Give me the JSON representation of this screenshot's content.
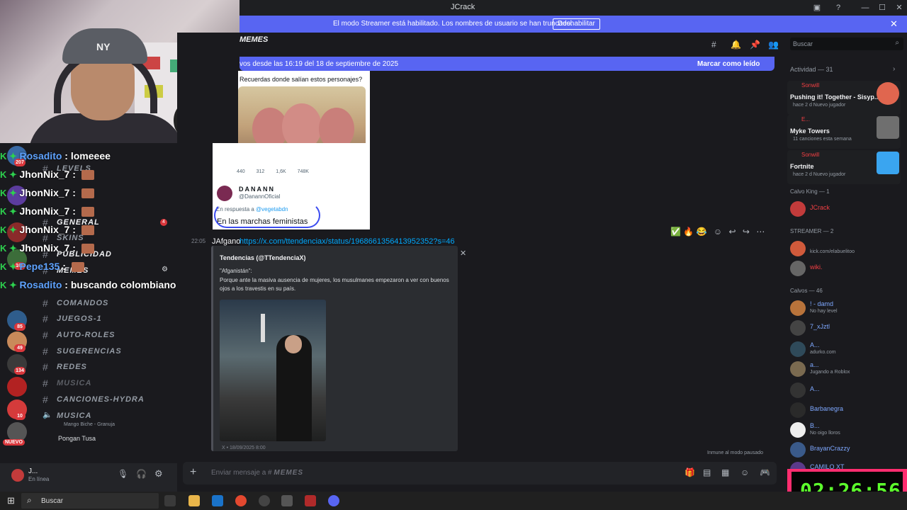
{
  "window": {
    "title": "JCrack"
  },
  "streamer_banner": {
    "text": "El modo Streamer está habilitado. Los nombres de usuario se han truncado.",
    "button": "Deshabilitar"
  },
  "channel_header": {
    "name": "MEMES"
  },
  "new_messages": {
    "text": "vos desde las 16:19 del 18 de septiembre de 2025",
    "mark_read": "Marcar como leído"
  },
  "chat_overlay": [
    {
      "user": "Rosadito",
      "message": "lomeeee"
    },
    {
      "user": "JhonNix_7",
      "message": ""
    },
    {
      "user": "JhonNix_7",
      "message": ""
    },
    {
      "user": "JhonNix_7",
      "message": ""
    },
    {
      "user": "JhonNix_7",
      "message": ""
    },
    {
      "user": "JhonNix_7",
      "message": ""
    },
    {
      "user": "Pepe135",
      "message": ""
    },
    {
      "user": "Rosadito",
      "message": "buscando colombiano"
    }
  ],
  "server_badges": [
    "207",
    "85",
    "49",
    "134",
    "10",
    "NUEVO",
    "10",
    "10",
    "166"
  ],
  "channels": [
    {
      "name": "LEVELS",
      "state": "normal"
    },
    {
      "name": "GENERAL",
      "state": "bright",
      "badge": "4"
    },
    {
      "name": "SKINS",
      "state": "normal"
    },
    {
      "name": "PUBLICIDAD",
      "state": "bright"
    },
    {
      "name": "MEMES",
      "state": "bright"
    },
    {
      "name": "COMANDOS",
      "state": "normal"
    },
    {
      "name": "JUEGOS-1",
      "state": "normal"
    },
    {
      "name": "AUTO-ROLES",
      "state": "normal"
    },
    {
      "name": "SUGERENCIAS",
      "state": "normal"
    },
    {
      "name": "REDES",
      "state": "normal"
    },
    {
      "name": "MUSICA",
      "state": "dim"
    },
    {
      "name": "CANCIONES-HYDRA",
      "state": "normal"
    },
    {
      "name": "MUSICA",
      "state": "normal"
    }
  ],
  "voice": {
    "activity": "Mango Biche - Granuja",
    "listener": "Pongan Tusa"
  },
  "user_panel": {
    "name": "J...",
    "status": "En línea"
  },
  "tweet_top": {
    "question": "Recuerdas donde salían estos personajes?",
    "stats": "440 312 1,6K 748K"
  },
  "tweet_reply": {
    "name": "DANANN",
    "handle": "@DanannOficial",
    "reply_prefix": "En respuesta a",
    "reply_to": "@vegetabdn",
    "body": "En las marchas feministas"
  },
  "message": {
    "time": "22:05",
    "author": "JAfgano",
    "link": "https://x.com/ttendenciax/status/1968661356413952352?s=46"
  },
  "embed": {
    "author": "Tendencias (@TTendenciaX)",
    "title": "\"Afganistán\":",
    "description": "Porque ante la masiva ausencia de mujeres, los musulmanes empezaron a ver con buenos ojos a los travestis en su país.",
    "footer": "X • 18/09/2025 8:00"
  },
  "immune_note": "Inmune al modo pausado",
  "composer": {
    "placeholder_prefix": "Enviar mensaje a #",
    "placeholder_channel": "MEMES"
  },
  "search": {
    "placeholder": "Buscar"
  },
  "activity": {
    "header": "Actividad — 31",
    "cards": [
      {
        "who": "Sonwill",
        "what": "Pushing it! Together - Sisyp...",
        "meta": "hace 2 d  Nuevo jugador",
        "color": "#e0664f"
      },
      {
        "who": "E...",
        "what": "Myke Towers",
        "meta": "11 canciones esta semana",
        "color": "#8a8a8a"
      },
      {
        "who": "Sonwill",
        "what": "Fortnite",
        "meta": "hace 2 d  Nuevo jugador",
        "color": "#3aa5f0"
      }
    ]
  },
  "member_sections": [
    {
      "title": "Calvo King — 1",
      "members": [
        {
          "name": "JCrack",
          "sub": "",
          "color": "#f23f43"
        }
      ]
    },
    {
      "title": "STREAMER — 2",
      "members": [
        {
          "name": "",
          "sub": "kick.com/elabuelitoo",
          "color": "#f2f3f5"
        },
        {
          "name": "wiki.",
          "sub": "",
          "color": "#f23f43"
        }
      ]
    },
    {
      "title": "Calvos — 46",
      "members": [
        {
          "name": "! - damd",
          "sub": "No hay level",
          "color": "#7ea8ff"
        },
        {
          "name": "7_xJztl",
          "sub": "",
          "color": "#7ea8ff"
        },
        {
          "name": "A...",
          "sub": "adurko.com",
          "color": "#7ea8ff"
        },
        {
          "name": "a...",
          "sub": "Jugando a Roblox",
          "color": "#7ea8ff"
        },
        {
          "name": "A...",
          "sub": "",
          "color": "#7ea8ff"
        },
        {
          "name": "Barbanegra",
          "sub": "",
          "color": "#7ea8ff"
        },
        {
          "name": "B...",
          "sub": "No oigo lloros",
          "color": "#7ea8ff"
        },
        {
          "name": "BrayanCrazzy",
          "sub": "",
          "color": "#7ea8ff"
        },
        {
          "name": "CAMILO XT",
          "sub": "",
          "color": "#7ea8ff"
        }
      ]
    }
  ],
  "stream_timer": "02:26:56",
  "taskbar": {
    "search": "Buscar"
  }
}
